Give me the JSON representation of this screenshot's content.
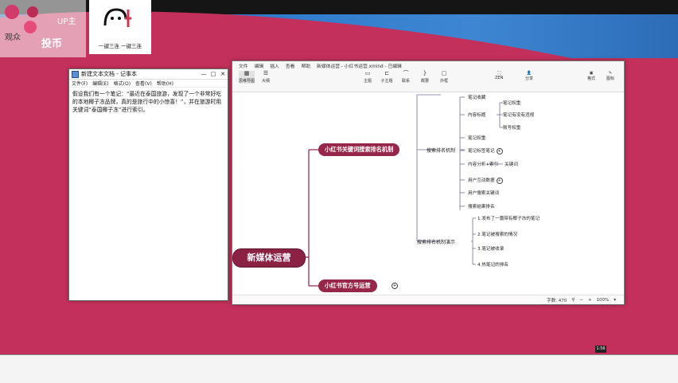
{
  "sticker": {
    "left_text": "观众",
    "upper_text": "UP主",
    "coin_text": "投币",
    "caption": "一键三连 一键三连"
  },
  "notepad": {
    "title": "新建文本文档 - 记事本",
    "menu": [
      "文件(F)",
      "编辑(E)",
      "格式(O)",
      "查看(V)",
      "帮助(H)"
    ],
    "controls": [
      "—",
      "□",
      "✕"
    ],
    "body": "假设我们有一个笔记：“最近在泰国旅游，发现了一个非常好吃的本地椰子冻品牌，真的是旅行中的小惊喜！”，并在旅游时用关键词“泰国椰子冻”进行索引。"
  },
  "mindmap": {
    "menu": [
      "文件",
      "编辑",
      "插入",
      "查看",
      "帮助",
      "新媒体运营 - 小红书运营.xmind - 已编辑"
    ],
    "ribbon_left": [
      {
        "icon": "outline-icon",
        "label": "思维导图"
      },
      {
        "icon": "doc-icon",
        "label": "大纲"
      }
    ],
    "ribbon_mid": [
      {
        "icon": "topic-icon",
        "label": "主题"
      },
      {
        "icon": "subtopic-icon",
        "label": "子主题"
      },
      {
        "icon": "relation-icon",
        "label": "联系"
      },
      {
        "icon": "summary-icon",
        "label": "概要"
      },
      {
        "icon": "boundary-icon",
        "label": "外框"
      }
    ],
    "ribbon_right": [
      {
        "icon": "zen-icon",
        "label": "ZEN"
      },
      {
        "icon": "share-icon",
        "label": "分享"
      },
      {
        "icon": "format-icon",
        "label": "格式"
      },
      {
        "icon": "marker-icon",
        "label": "图标"
      }
    ],
    "root": "新媒体运营",
    "branches": [
      {
        "label": "小红书关键词搜索排名机制"
      },
      {
        "label": "小红书官方号运营"
      }
    ],
    "level2": [
      {
        "label": "搜索排名机制"
      },
      {
        "label": "搜索排名机制演示"
      }
    ],
    "level3": [
      "内容标题",
      "笔记权重",
      "笔记收藏",
      "笔记标签笔记",
      "内容分析+索引",
      "用户互动数据",
      "用户搜索关键词",
      "搜索结果排名",
      "1.发布了一篇带有椰子冻的笔记",
      "2.笔记被搜索的情况",
      "3.笔记被收录",
      "4.热笔记的排名"
    ],
    "level4": [
      "笔记权重",
      "笔记有没有违规",
      "账号权重",
      "关键词"
    ],
    "status": {
      "words": "字数: 470",
      "zoom": "100%"
    }
  },
  "taskbar": {
    "badge": "1:56"
  }
}
